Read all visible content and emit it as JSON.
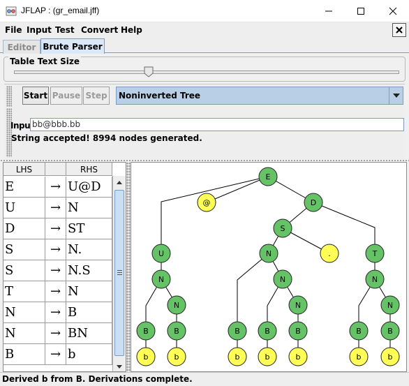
{
  "window": {
    "title": "JFLAP : (gr_email.jff)"
  },
  "menu": [
    "File",
    "Input",
    "Test",
    "Convert",
    "Help"
  ],
  "tabs": {
    "editor": "Editor",
    "brute": "Brute Parser"
  },
  "table_text_size": {
    "label": "Table Text Size",
    "slider_value": 0.35
  },
  "toolbar": {
    "start": "Start",
    "pause": "Pause",
    "step": "Step",
    "tree_mode": "Noninverted Tree"
  },
  "input": {
    "label": "Input",
    "value": "bb@bbb.bb"
  },
  "status_message": "String accepted!  8994 nodes generated.",
  "grammar_table": {
    "headers": [
      "LHS",
      "",
      "RHS"
    ],
    "arrow": "→",
    "rows": [
      {
        "lhs": "E",
        "rhs": "U@D"
      },
      {
        "lhs": "U",
        "rhs": "N"
      },
      {
        "lhs": "D",
        "rhs": "ST"
      },
      {
        "lhs": "S",
        "rhs": "N."
      },
      {
        "lhs": "S",
        "rhs": "N.S"
      },
      {
        "lhs": "T",
        "rhs": "N"
      },
      {
        "lhs": "N",
        "rhs": "B"
      },
      {
        "lhs": "N",
        "rhs": "BN"
      },
      {
        "lhs": "B",
        "rhs": "b"
      }
    ]
  },
  "tree": {
    "colors": {
      "nonterminal": "#66c266",
      "terminal": "#ffff55",
      "edge": "#000000"
    },
    "nodes": [
      {
        "id": "E",
        "label": "E",
        "kind": "nonterminal"
      },
      {
        "id": "at",
        "label": "@",
        "kind": "terminal"
      },
      {
        "id": "D",
        "label": "D",
        "kind": "nonterminal"
      },
      {
        "id": "S",
        "label": "S",
        "kind": "nonterminal"
      },
      {
        "id": "U",
        "label": "U",
        "kind": "nonterminal"
      },
      {
        "id": "N_s",
        "label": "N",
        "kind": "nonterminal"
      },
      {
        "id": "dot",
        "label": ".",
        "kind": "terminal"
      },
      {
        "id": "T",
        "label": "T",
        "kind": "nonterminal"
      },
      {
        "id": "N1",
        "label": "N",
        "kind": "nonterminal"
      },
      {
        "id": "N3",
        "label": "N",
        "kind": "nonterminal"
      },
      {
        "id": "N5",
        "label": "N",
        "kind": "nonterminal"
      },
      {
        "id": "N2",
        "label": "N",
        "kind": "nonterminal"
      },
      {
        "id": "N4",
        "label": "N",
        "kind": "nonterminal"
      },
      {
        "id": "N6",
        "label": "N",
        "kind": "nonterminal"
      },
      {
        "id": "B1",
        "label": "B",
        "kind": "nonterminal"
      },
      {
        "id": "B2",
        "label": "B",
        "kind": "nonterminal"
      },
      {
        "id": "B3",
        "label": "B",
        "kind": "nonterminal"
      },
      {
        "id": "B4",
        "label": "B",
        "kind": "nonterminal"
      },
      {
        "id": "B5",
        "label": "B",
        "kind": "nonterminal"
      },
      {
        "id": "B6",
        "label": "B",
        "kind": "nonterminal"
      },
      {
        "id": "B7",
        "label": "B",
        "kind": "nonterminal"
      },
      {
        "id": "b1",
        "label": "b",
        "kind": "terminal"
      },
      {
        "id": "b2",
        "label": "b",
        "kind": "terminal"
      },
      {
        "id": "b3",
        "label": "b",
        "kind": "terminal"
      },
      {
        "id": "b4",
        "label": "b",
        "kind": "terminal"
      },
      {
        "id": "b5",
        "label": "b",
        "kind": "terminal"
      },
      {
        "id": "b6",
        "label": "b",
        "kind": "terminal"
      },
      {
        "id": "b7",
        "label": "b",
        "kind": "terminal"
      }
    ],
    "edges": [
      [
        "E",
        "U"
      ],
      [
        "E",
        "at"
      ],
      [
        "E",
        "D"
      ],
      [
        "D",
        "S"
      ],
      [
        "D",
        "T"
      ],
      [
        "S",
        "N_s"
      ],
      [
        "S",
        "dot"
      ],
      [
        "U",
        "N1"
      ],
      [
        "N1",
        "B1"
      ],
      [
        "N1",
        "N2"
      ],
      [
        "N2",
        "B2"
      ],
      [
        "N_s",
        "B3"
      ],
      [
        "N_s",
        "N3"
      ],
      [
        "N3",
        "B4"
      ],
      [
        "N3",
        "N4"
      ],
      [
        "N4",
        "B5"
      ],
      [
        "T",
        "N5"
      ],
      [
        "N5",
        "B6"
      ],
      [
        "N5",
        "N6"
      ],
      [
        "N6",
        "B7"
      ],
      [
        "B1",
        "b1"
      ],
      [
        "B2",
        "b2"
      ],
      [
        "B3",
        "b3"
      ],
      [
        "B4",
        "b4"
      ],
      [
        "B5",
        "b5"
      ],
      [
        "B6",
        "b6"
      ],
      [
        "B7",
        "b7"
      ]
    ]
  },
  "bottom_status": "Derived b from B.  Derivations complete."
}
